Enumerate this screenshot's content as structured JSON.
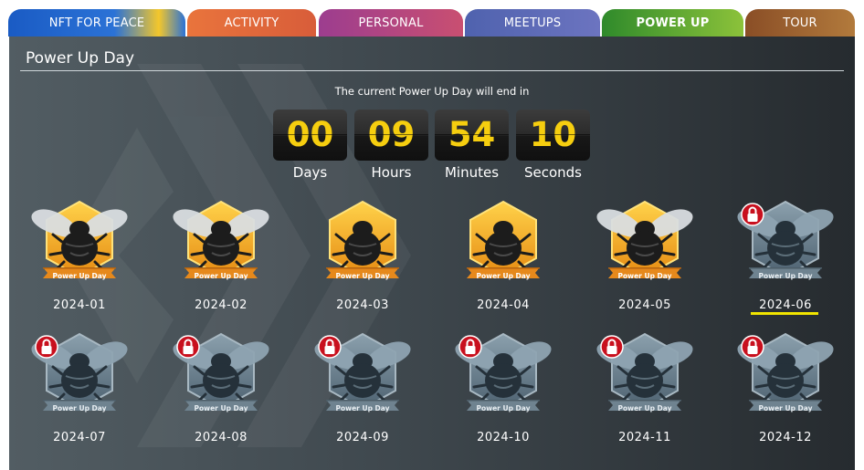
{
  "tabs": [
    {
      "label": "NFT FOR PEACE",
      "active": false
    },
    {
      "label": "ACTIVITY",
      "active": false
    },
    {
      "label": "PERSONAL",
      "active": false
    },
    {
      "label": "MEETUPS",
      "active": false
    },
    {
      "label": "POWER UP",
      "active": true
    },
    {
      "label": "TOUR",
      "active": false
    }
  ],
  "colors": {
    "tab_nft": "#1e63c6",
    "tab_activity": "#e1673a",
    "tab_personal": "#b1477f",
    "tab_meetups": "#5d6bb4",
    "tab_powerup": "#3f9c2f",
    "tab_tour": "#9a5b2c",
    "countdown_digits": "#f6ce0f",
    "selected_underline": "#f2e500"
  },
  "page": {
    "title": "Power Up Day",
    "countdown_label": "The current Power Up Day will end in"
  },
  "countdown": [
    {
      "value": "00",
      "label": "Days"
    },
    {
      "value": "09",
      "label": "Hours"
    },
    {
      "value": "54",
      "label": "Minutes"
    },
    {
      "value": "10",
      "label": "Seconds"
    }
  ],
  "badges": [
    {
      "date": "2024-01",
      "ribbon": "Power Up Day",
      "status": "unlocked",
      "wings": true
    },
    {
      "date": "2024-02",
      "ribbon": "Power Up Day",
      "status": "unlocked",
      "wings": true
    },
    {
      "date": "2024-03",
      "ribbon": "Power Up Day",
      "status": "unlocked",
      "wings": false
    },
    {
      "date": "2024-04",
      "ribbon": "Power Up Day",
      "status": "unlocked",
      "wings": false
    },
    {
      "date": "2024-05",
      "ribbon": "Power Up Day",
      "status": "unlocked",
      "wings": true
    },
    {
      "date": "2024-06",
      "ribbon": "Power Up Day",
      "status": "locked",
      "wings": true,
      "selected": true
    },
    {
      "date": "2024-07",
      "ribbon": "Power Up Day",
      "status": "locked",
      "wings": true
    },
    {
      "date": "2024-08",
      "ribbon": "Power Up Day",
      "status": "locked",
      "wings": true
    },
    {
      "date": "2024-09",
      "ribbon": "Power Up Day",
      "status": "locked",
      "wings": true
    },
    {
      "date": "2024-10",
      "ribbon": "Power Up Day",
      "status": "locked",
      "wings": true
    },
    {
      "date": "2024-11",
      "ribbon": "Power Up Day",
      "status": "locked",
      "wings": true
    },
    {
      "date": "2024-12",
      "ribbon": "Power Up Day",
      "status": "locked",
      "wings": true
    }
  ]
}
